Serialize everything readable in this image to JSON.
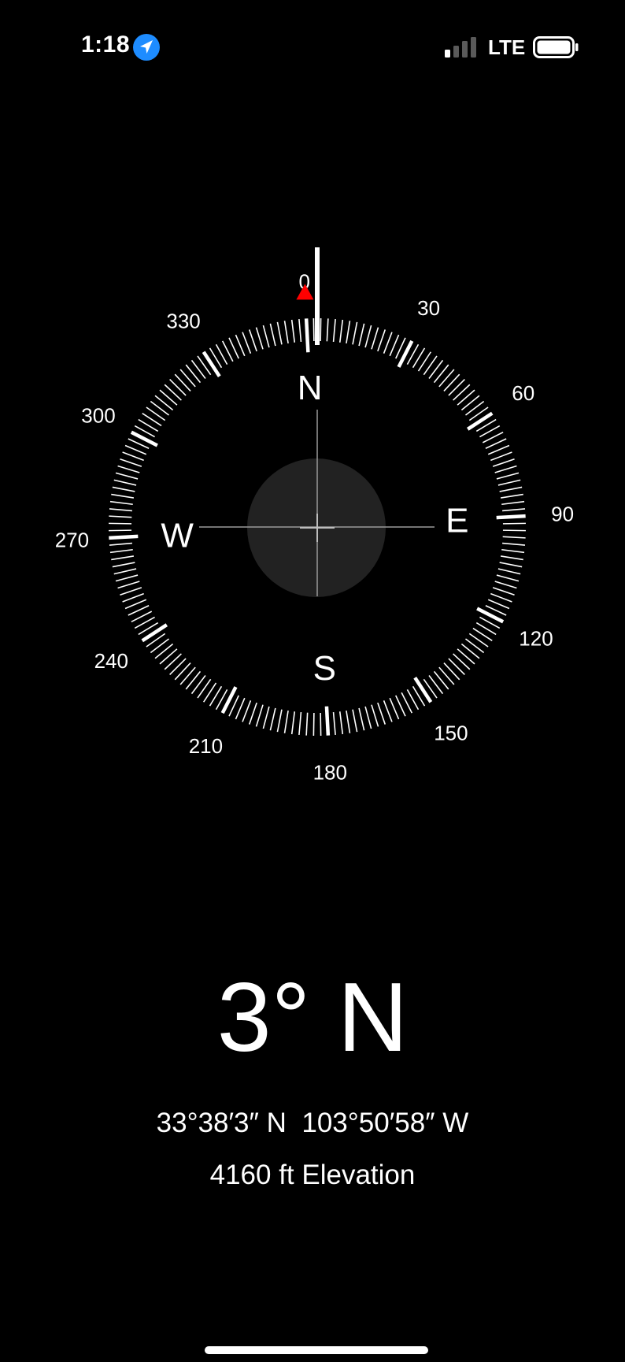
{
  "status_bar": {
    "time": "1:18",
    "network": "LTE",
    "signal_bars_active": 1,
    "signal_bars_total": 4,
    "icons": [
      "location-arrow-icon",
      "signal-icon",
      "battery-icon"
    ]
  },
  "compass": {
    "heading_degrees": 3,
    "cardinals": {
      "north": "N",
      "east": "E",
      "south": "S",
      "west": "W"
    },
    "degree_labels": [
      "0",
      "30",
      "60",
      "90",
      "120",
      "150",
      "180",
      "210",
      "240",
      "270",
      "300",
      "330"
    ],
    "target_marker_color": "#ff0000"
  },
  "readout": {
    "heading_text": "3° N",
    "coordinates": "33°38′3″ N  103°50′58″ W",
    "elevation": "4160 ft Elevation"
  },
  "colors": {
    "background": "#000000",
    "foreground": "#ffffff",
    "location_icon": "#1e8cff",
    "level_bubble": "#222222",
    "signal_inactive": "#5a5a5a"
  }
}
